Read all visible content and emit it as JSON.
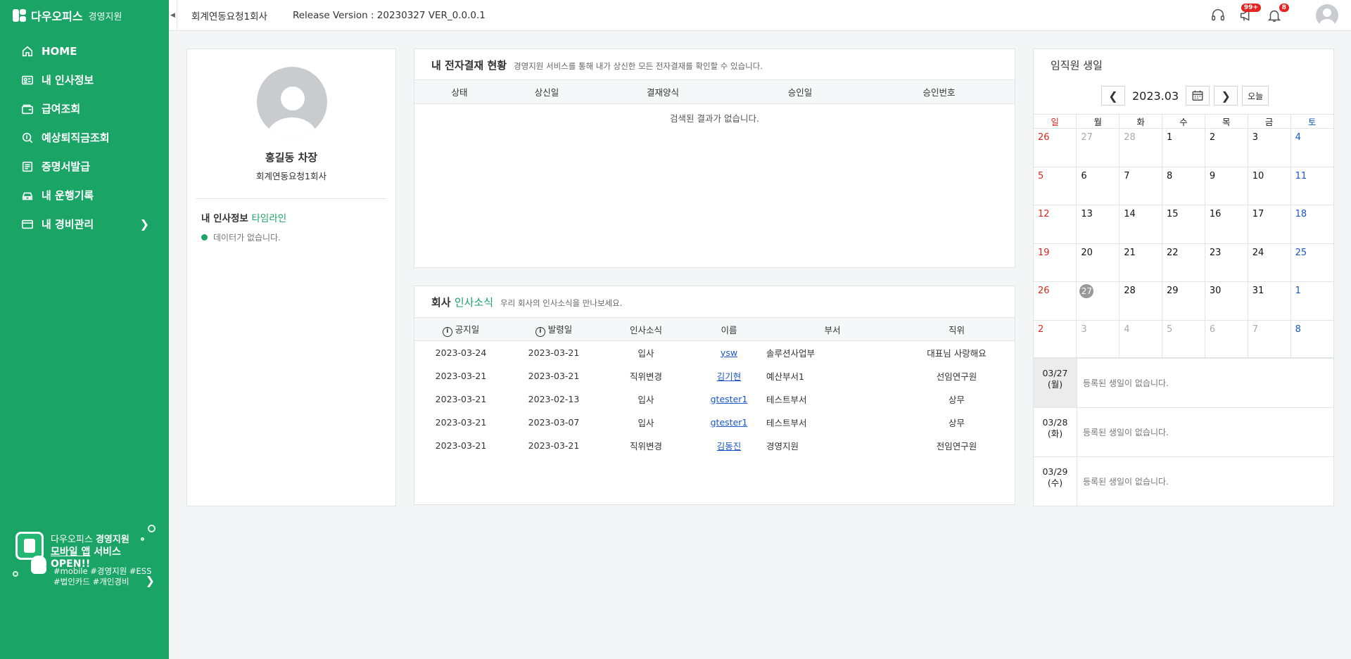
{
  "sidebar": {
    "logo_title": "다우오피스",
    "logo_sub": "경영지원",
    "items": [
      {
        "label": "HOME"
      },
      {
        "label": "내 인사정보"
      },
      {
        "label": "급여조회"
      },
      {
        "label": "예상퇴직금조회"
      },
      {
        "label": "증명서발급"
      },
      {
        "label": "내 운행기록"
      },
      {
        "label": "내 경비관리"
      }
    ],
    "promo": {
      "line1_a": "다우오피스 ",
      "line1_b": "경영지원",
      "line2_a": "모바일 앱",
      "line2_b": " 서비스 OPEN!!",
      "tags1": "#mobile #경영지원 #ESS",
      "tags2": "#법인카드 #개인경비"
    }
  },
  "header": {
    "company": "회계연동요청1회사",
    "release": "Release Version : 20230327 VER_0.0.0.1",
    "badge_notice": "99+",
    "badge_alarm": "8"
  },
  "profile": {
    "name": "홍길동 차장",
    "company": "회계연동요청1회사",
    "timeline_label": "내 인사정보 ",
    "timeline_accent": "타임라인",
    "nodata": "데이터가 없습니다."
  },
  "approval": {
    "title": "내 전자결재 현황",
    "desc": "경영지원 서비스를 통해 내가 상신한 모든 전자결재를 확인할 수 있습니다.",
    "columns": [
      "상태",
      "상신일",
      "결재양식",
      "승인일",
      "승인번호"
    ],
    "empty": "검색된 결과가 없습니다."
  },
  "news": {
    "title_a": "회사 ",
    "title_b": "인사소식",
    "desc": "우리 회사의 인사소식을 만나보세요.",
    "columns": [
      "공지일",
      "발령일",
      "인사소식",
      "이름",
      "부서",
      "직위"
    ],
    "rows": [
      [
        "2023-03-24",
        "2023-03-21",
        "입사",
        "ysw",
        "솔루션사업부",
        "대표님 사랑해요"
      ],
      [
        "2023-03-21",
        "2023-03-21",
        "직위변경",
        "김기현",
        "예산부서1",
        "선임연구원"
      ],
      [
        "2023-03-21",
        "2023-02-13",
        "입사",
        "gtester1",
        "테스트부서",
        "상무"
      ],
      [
        "2023-03-21",
        "2023-03-07",
        "입사",
        "gtester1",
        "테스트부서",
        "상무"
      ],
      [
        "2023-03-21",
        "2023-03-21",
        "직위변경",
        "김동진",
        "경영지원",
        "전임연구원"
      ]
    ]
  },
  "birthday": {
    "title": "임직원 생일",
    "month": "2023.03",
    "today_btn": "오늘",
    "weekdays": [
      "일",
      "월",
      "화",
      "수",
      "목",
      "금",
      "토"
    ],
    "weeks": [
      [
        "26",
        "27",
        "28",
        "1",
        "2",
        "3",
        "4"
      ],
      [
        "5",
        "6",
        "7",
        "8",
        "9",
        "10",
        "11"
      ],
      [
        "12",
        "13",
        "14",
        "15",
        "16",
        "17",
        "18"
      ],
      [
        "19",
        "20",
        "21",
        "22",
        "23",
        "24",
        "25"
      ],
      [
        "26",
        "27",
        "28",
        "29",
        "30",
        "31",
        "1"
      ],
      [
        "2",
        "3",
        "4",
        "5",
        "6",
        "7",
        "8"
      ]
    ],
    "list": [
      {
        "date": "03/27",
        "day": "(월)",
        "msg": "등록된 생일이 없습니다."
      },
      {
        "date": "03/28",
        "day": "(화)",
        "msg": "등록된 생일이 없습니다."
      },
      {
        "date": "03/29",
        "day": "(수)",
        "msg": "등록된 생일이 없습니다."
      }
    ]
  }
}
